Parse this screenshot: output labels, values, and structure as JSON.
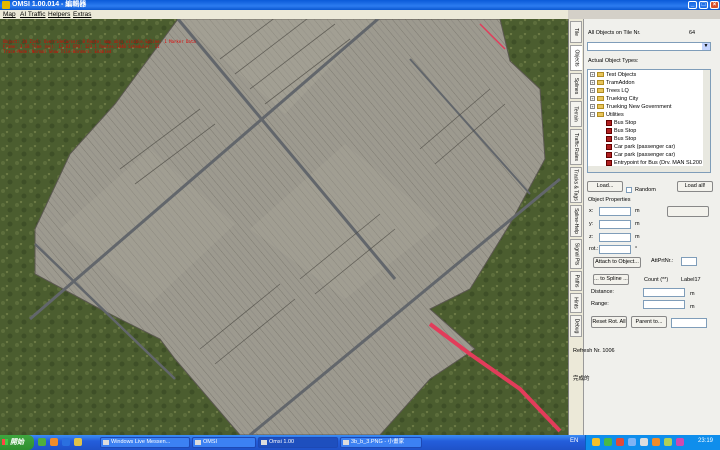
{
  "window": {
    "title": "OMSI 1.00.014 - 編輯器"
  },
  "menu": [
    "Map",
    "AI Traffic",
    "Helpers",
    "Extras"
  ],
  "debug_lines": [
    "Object: 34 Ziel: OverrideCursor: 0 Route: map_objs_visible.Spline: 1 Marker Data",
    "Frame: 3.18 Time (ms): 12.03 CPU: 123.1 Routes:1040 Scheduler: 11",
    "Trace-Mode: Normal   Show Tile-Borders: Enabled"
  ],
  "side_tabs": [
    "Tile",
    "Objects",
    "Splines",
    "Terrain",
    "Traffic Rules",
    "Tracks & Tags",
    "Spline-Help",
    "Signal Pts",
    "Paths",
    "Hints",
    "Debug"
  ],
  "panel": {
    "all_objects_label": "All Objects on Tile Nr.",
    "tile_count": "64",
    "actual_types_label": "Actual Object Types:",
    "tree": [
      {
        "label": "Test Objects",
        "kind": "folder",
        "expanded": false
      },
      {
        "label": "TramAddon",
        "kind": "folder",
        "expanded": false
      },
      {
        "label": "Trees LQ",
        "kind": "folder",
        "expanded": false
      },
      {
        "label": "Trueking City",
        "kind": "folder",
        "expanded": false
      },
      {
        "label": "Trueking New Government",
        "kind": "folder",
        "expanded": false
      },
      {
        "label": "Utilities",
        "kind": "folder",
        "expanded": true
      },
      {
        "label": "Bus Stop",
        "kind": "object"
      },
      {
        "label": "Bus Stop",
        "kind": "object"
      },
      {
        "label": "Bus Stop",
        "kind": "object"
      },
      {
        "label": "Car park (passenger car)",
        "kind": "object"
      },
      {
        "label": "Car park (passenger car)",
        "kind": "object"
      },
      {
        "label": "Entrypoint for Bus (Drv. MAN SL200",
        "kind": "object"
      }
    ],
    "load_button": "Load...",
    "random_label": "Random",
    "load_all_button": "Load all!",
    "object_properties_label": "Object Properties",
    "coord_labels": [
      "x:",
      "y:",
      "z:",
      "rot.:"
    ],
    "unit_m": "m",
    "unit_deg": "°",
    "attach_button": "Attach to Object...",
    "att_prt_label": "AttPrtNr.:",
    "to_spline_button": "... to Spline ...",
    "count_label": "Count (**)",
    "label17": "Label17",
    "distance_label": "Distance:",
    "range_label": "Range:",
    "reset_rot_button": "Reset Rot. All",
    "parent_button": "Parent to..."
  },
  "status": {
    "refresh": "Refresh Nr. 1006",
    "done": "完成的"
  },
  "taskbar": {
    "start_label": "開始",
    "tasks": [
      "Windows Live Messen...",
      "OMSI",
      "Omsi 1.00",
      "3b_b_3.PNG - 小畫家"
    ],
    "lang": "EN",
    "clock": "23:19"
  },
  "colors": {
    "titlebar": "#0a5ad8",
    "grass": "#4b5d2f",
    "paving": "#9d9a8f",
    "road": "#62666b",
    "curb_marker": "#e23c5a"
  }
}
